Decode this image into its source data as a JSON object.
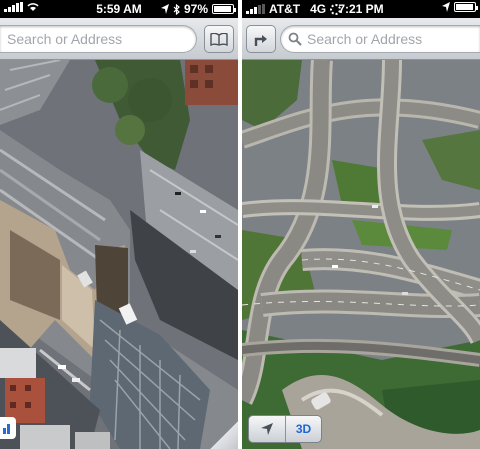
{
  "left_phone": {
    "status": {
      "time": "5:59 AM",
      "battery": "97%",
      "battery_level": 0.97,
      "signal_bars": 5
    },
    "search": {
      "placeholder": "Search or Address"
    },
    "icons": {
      "bookmarks": "book-icon",
      "legend": "bar-chart-icon",
      "location": "location-arrow-icon",
      "bluetooth": "bluetooth-icon"
    }
  },
  "right_phone": {
    "status": {
      "carrier": "AT&T",
      "network": "4G",
      "time": "7:21 PM",
      "signal_bars": 3
    },
    "search": {
      "placeholder": "Search or Address"
    },
    "controls": {
      "three_d_label": "3D"
    },
    "icons": {
      "directions": "directions-arrow-icon",
      "search": "search-icon",
      "location": "location-arrow-icon",
      "activity": "spinner-icon"
    }
  },
  "colors": {
    "accent": "#1d66d6",
    "toolbar": "#d3d7dc"
  }
}
